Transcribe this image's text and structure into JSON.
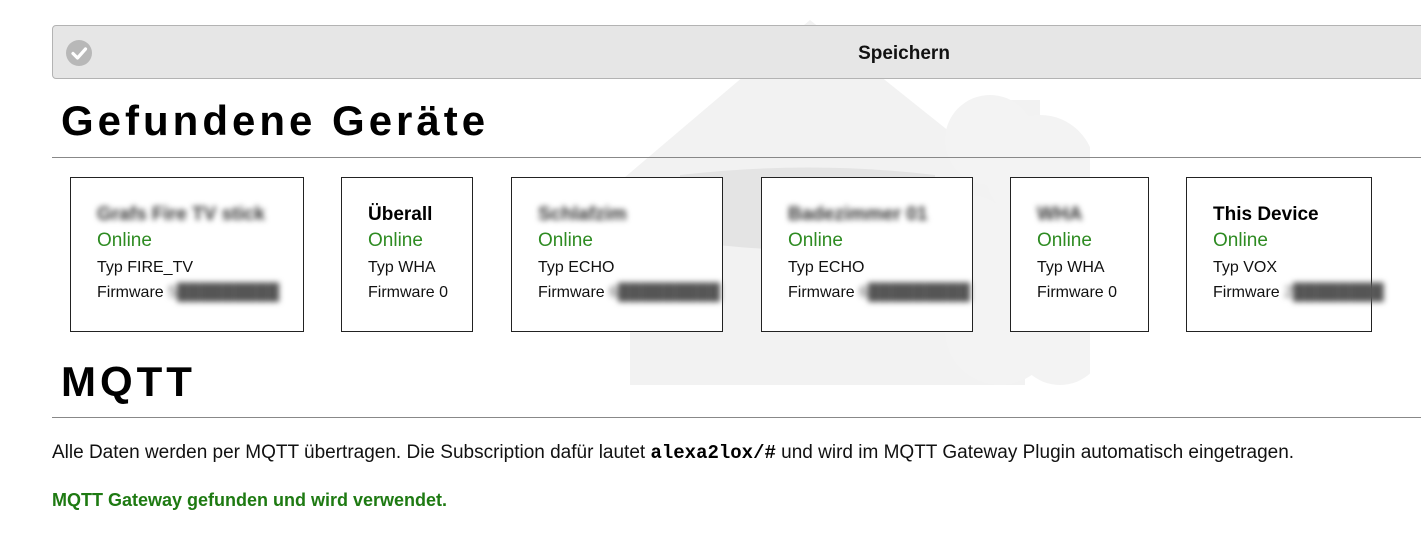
{
  "toolbar": {
    "save_label": "Speichern",
    "icon": "check-circle-icon"
  },
  "devices_section": {
    "title": "Gefundene Geräte"
  },
  "devices": [
    {
      "name": "Grafs Fire TV stick",
      "status": "Online",
      "type": "Typ FIRE_TV",
      "firmware_label": "Firmware",
      "firmware_value": "5█████████",
      "name_blurred": true
    },
    {
      "name": "Überall",
      "status": "Online",
      "type": "Typ WHA",
      "firmware_label": "Firmware",
      "firmware_value": "0",
      "name_blurred": false
    },
    {
      "name": "Schlafzim",
      "status": "Online",
      "type": "Typ ECHO",
      "firmware_label": "Firmware",
      "firmware_value": "6█████████",
      "name_blurred": true
    },
    {
      "name": "Badezimmer 01",
      "status": "Online",
      "type": "Typ ECHO",
      "firmware_label": "Firmware",
      "firmware_value": "6█████████",
      "name_blurred": true
    },
    {
      "name": "WHA",
      "status": "Online",
      "type": "Typ WHA",
      "firmware_label": "Firmware",
      "firmware_value": "0",
      "name_blurred": true
    },
    {
      "name": "This Device",
      "status": "Online",
      "type": "Typ VOX",
      "firmware_label": "Firmware",
      "firmware_value": "2████████",
      "name_blurred": false
    }
  ],
  "mqtt_section": {
    "title": "MQTT",
    "desc_before": "Alle Daten werden per MQTT übertragen. Die Subscription dafür lautet ",
    "subscription": "alexa2lox/#",
    "desc_after": " und wird im MQTT Gateway Plugin automatisch eingetragen.",
    "status": "MQTT Gateway gefunden und wird verwendet."
  },
  "colors": {
    "online": "#2e8b22",
    "gateway_ok": "#1e7a12",
    "bar_bg": "#e6e6e6"
  }
}
